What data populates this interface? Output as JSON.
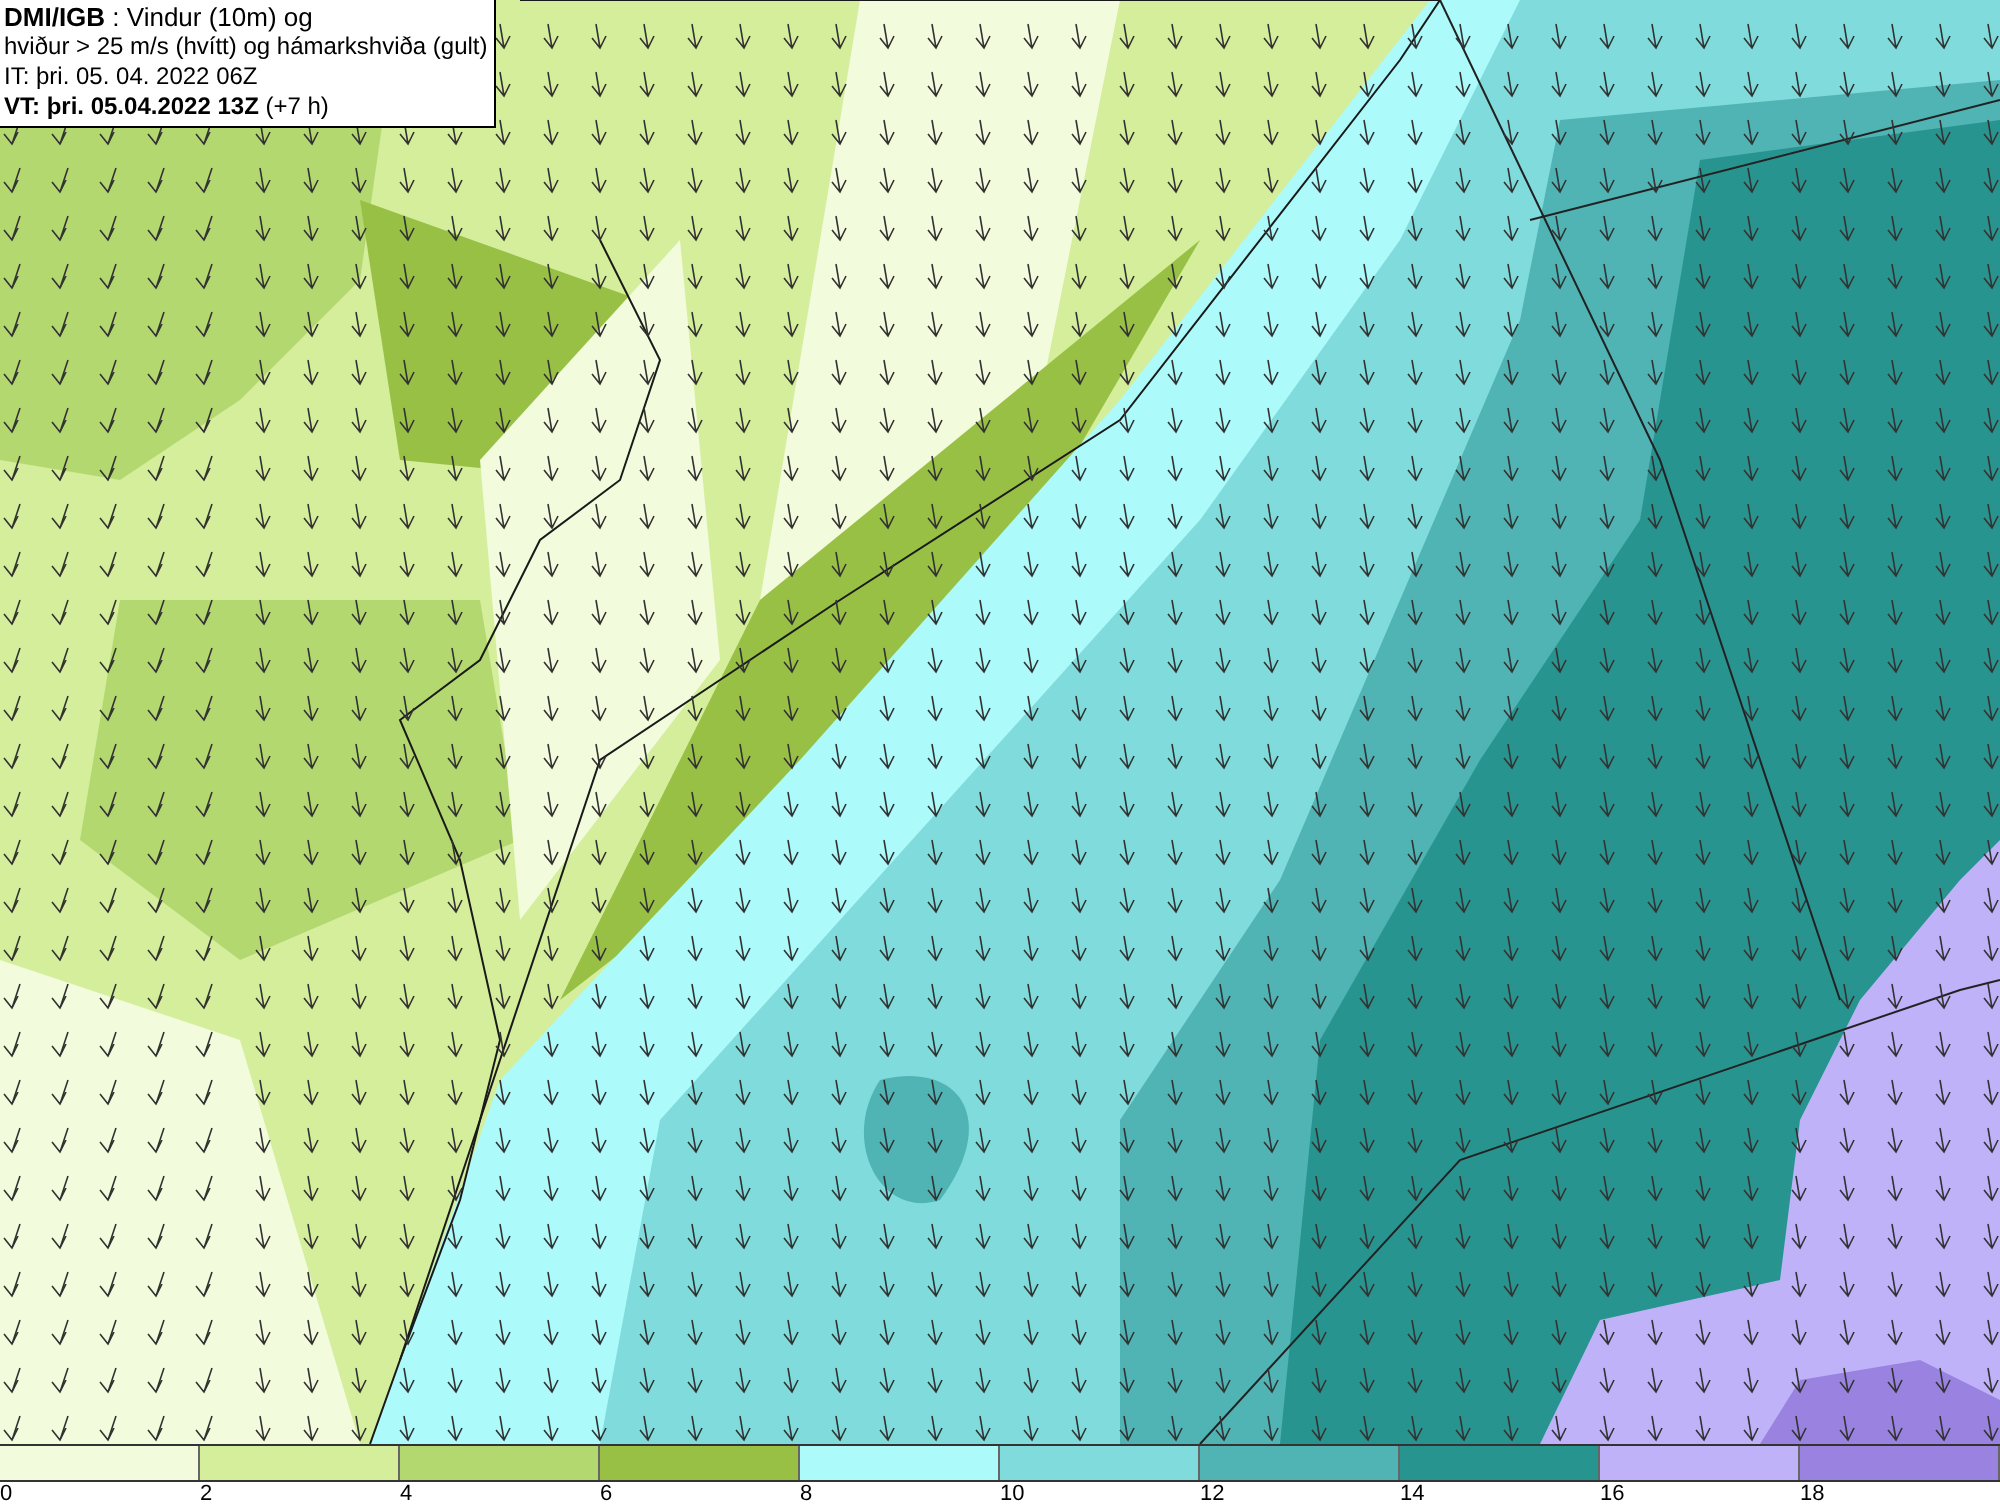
{
  "title_box": {
    "lines": [
      "**DMI/IGB** : Vindur (10m) og",
      "hviður > 25 m/s (hvítt) og hámarkshviða (gult)",
      "IT: þri. 05. 04. 2022 06Z",
      "**VT: þri. 05.04.2022 13Z** (+7 h)"
    ]
  },
  "legend": {
    "bins": [
      {
        "label": "0",
        "color": "#f2fbdc"
      },
      {
        "label": "2",
        "color": "#d4ee9c"
      },
      {
        "label": "4",
        "color": "#b4d870"
      },
      {
        "label": "6",
        "color": "#98c044"
      },
      {
        "label": "8",
        "color": "#acfafa"
      },
      {
        "label": "10",
        "color": "#80dcdc"
      },
      {
        "label": "12",
        "color": "#50b4b4"
      },
      {
        "label": "14",
        "color": "#289490"
      },
      {
        "label": "16",
        "color": "#c0b2f8"
      },
      {
        "label": "18",
        "color": "#9a82e0"
      }
    ]
  }
}
